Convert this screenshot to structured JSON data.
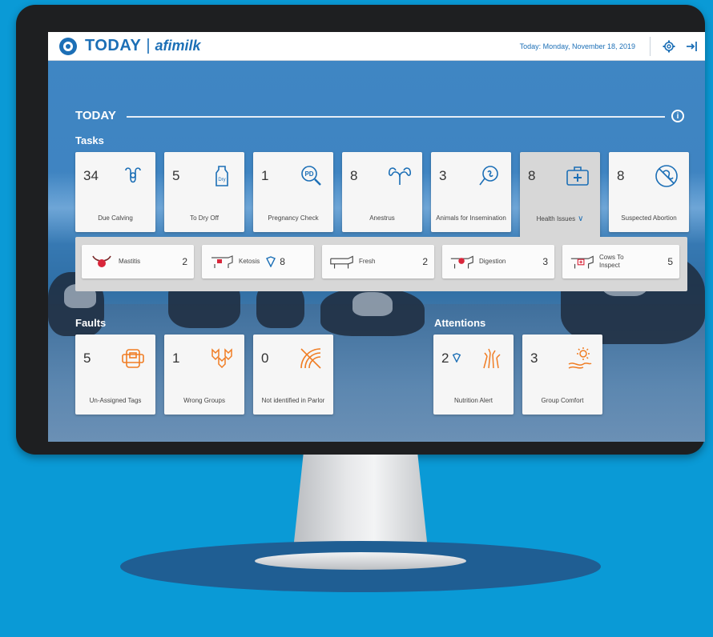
{
  "header": {
    "app_title": "TODAY",
    "brand": "afimilk",
    "date": "Today: Monday, November 18, 2019",
    "icons": [
      "gear-icon",
      "logout-icon"
    ]
  },
  "section_title": "TODAY",
  "tasks": {
    "label": "Tasks",
    "cards": [
      {
        "count": "34",
        "label": "Due Calving",
        "icon": "uterus-icon"
      },
      {
        "count": "5",
        "label": "To Dry Off",
        "icon": "milk-bottle-icon"
      },
      {
        "count": "1",
        "label": "Pregnancy Check",
        "icon": "pd-search-icon"
      },
      {
        "count": "8",
        "label": "Anestrus",
        "icon": "ovaries-icon"
      },
      {
        "count": "3",
        "label": "Animals for Insemination",
        "icon": "insemination-icon"
      },
      {
        "count": "8",
        "label": "Health Issues",
        "icon": "first-aid-kit-icon"
      },
      {
        "count": "8",
        "label": "Suspected Abortion",
        "icon": "abortion-icon"
      }
    ]
  },
  "health_issues": [
    {
      "label": "Mastitis",
      "count": "2",
      "icon": "udder-icon"
    },
    {
      "label": "Ketosis",
      "count": "8",
      "icon": "cow-ketosis-icon"
    },
    {
      "label": "Fresh",
      "count": "2",
      "icon": "cow-fresh-icon"
    },
    {
      "label": "Digestion",
      "count": "3",
      "icon": "cow-digestion-icon"
    },
    {
      "label": "Cows To Inspect",
      "count": "5",
      "icon": "cow-inspect-icon"
    }
  ],
  "faults": {
    "label": "Faults",
    "cards": [
      {
        "count": "5",
        "label": "Un-Assigned Tags",
        "icon": "tag-icon"
      },
      {
        "count": "1",
        "label": "Wrong Groups",
        "icon": "cow-group-icon"
      },
      {
        "count": "0",
        "label": "Not identified in Parlor",
        "icon": "no-signal-icon"
      }
    ]
  },
  "attentions": {
    "label": "Attentions",
    "cards": [
      {
        "count": "2",
        "label": "Nutrition Alert",
        "icon": "feed-icon"
      },
      {
        "count": "3",
        "label": "Group Comfort",
        "icon": "sun-comfort-icon"
      }
    ]
  },
  "colors": {
    "background": "#0a9ad6",
    "brand": "#1c6fb6",
    "accent_orange": "#f07d24",
    "health_red": "#d9263b"
  }
}
